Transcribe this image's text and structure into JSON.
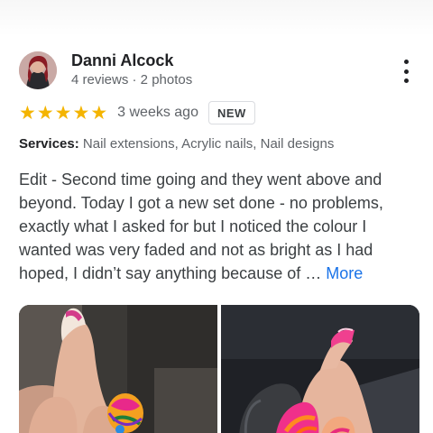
{
  "review": {
    "author": {
      "name": "Danni Alcock",
      "meta": "4 reviews · 2 photos"
    },
    "rating": {
      "stars": 5,
      "star_glyph": "★",
      "time_ago": "3 weeks ago",
      "badge": "NEW"
    },
    "services": {
      "label": "Services:",
      "value": "Nail extensions, Acrylic nails, Nail designs"
    },
    "text": "Edit - Second time going and they went above and beyond. Today I got a new set done - no problems, exactly what I asked for but I noticed the colour I wanted was very faded and not as bright as I had hoped, I didn’t say anything because of … ",
    "more_label": "More",
    "icons": {
      "menu": "more-vert-icon",
      "star": "star-icon"
    },
    "colors": {
      "star": "#f4b400",
      "link": "#1a73e8",
      "secondary_text": "#5f6368"
    }
  }
}
